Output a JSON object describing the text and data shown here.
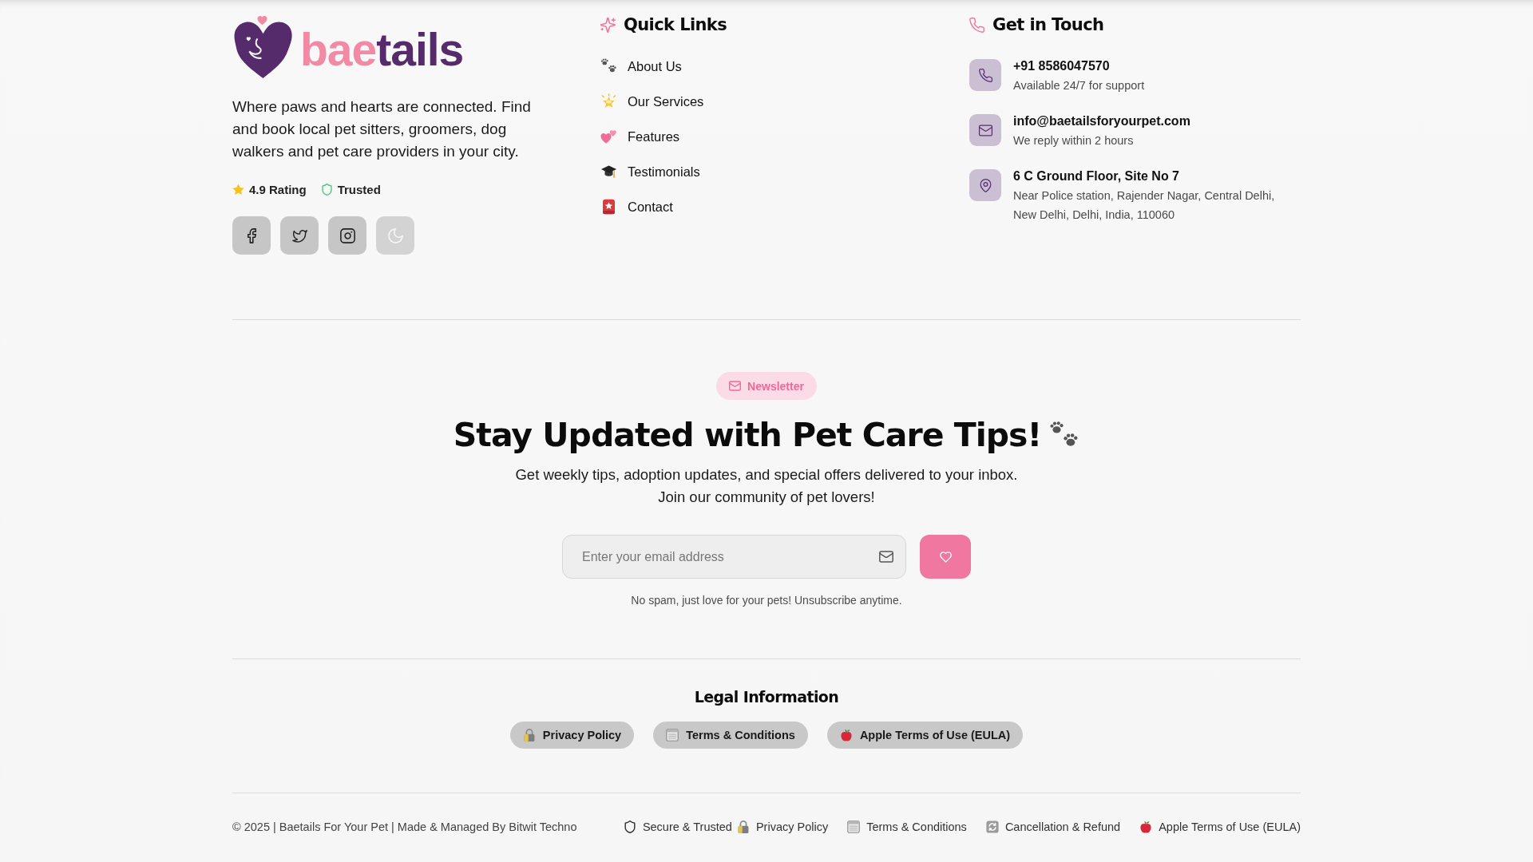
{
  "brand": {
    "logo": {
      "wordmark_start": "bae",
      "wordmark_end": "tails"
    },
    "description": "Where paws and hearts are connected. Find and book local pet sitters, groomers, dog walkers and pet care providers in your city.",
    "badges": [
      {
        "kind": "rating",
        "label": "4.9 Rating"
      },
      {
        "kind": "trusted",
        "label": "Trusted"
      }
    ],
    "social_links": [
      {
        "kind": "facebook",
        "disabled": false
      },
      {
        "kind": "twitter",
        "disabled": false
      },
      {
        "kind": "instagram",
        "disabled": false
      },
      {
        "kind": "moon",
        "disabled": true
      }
    ]
  },
  "quick_links": {
    "title": "Quick Links",
    "links": [
      "About Us",
      "Our Services",
      "Features",
      "Testimonials",
      "Contact"
    ]
  },
  "contact": {
    "title": "Get in Touch",
    "items": [
      {
        "kind": "phone",
        "title": "+91 8586047570",
        "detail": "Available 24/7 for support"
      },
      {
        "kind": "email",
        "title": "info@baetailsforyourpet.com",
        "detail": "We reply within 2 hours"
      },
      {
        "kind": "address",
        "title": "6 C Ground Floor, Site No 7",
        "detail": "Near Police station, Rajender Nagar, Central Delhi, New Delhi, Delhi, India, 110060"
      }
    ]
  },
  "newsletter": {
    "badge": "Newsletter",
    "title": "Stay Updated with Pet Care Tips!",
    "subtitle": "Get weekly tips, adoption updates, and special offers delivered to your inbox. Join our community of pet lovers!",
    "email_field": {
      "placeholder": "Enter your email address"
    },
    "note": "No spam, just love for your pets! Unsubscribe anytime."
  },
  "legal": {
    "title": "Legal Information",
    "links": [
      {
        "kind": "privacy",
        "label": "Privacy Policy"
      },
      {
        "kind": "terms",
        "label": "Terms & Conditions"
      },
      {
        "kind": "apple",
        "label": "Apple Terms of Use (EULA)"
      }
    ]
  },
  "bottom_bar": {
    "copyright": "© 2025 | Baetails For Your Pet | Made & Managed By Bitwit Techno",
    "secure_label": "Secure & Trusted",
    "links": [
      {
        "kind": "privacy",
        "label": "Privacy Policy"
      },
      {
        "kind": "terms",
        "label": "Terms & Conditions"
      },
      {
        "kind": "refund",
        "label": "Cancellation & Refund"
      },
      {
        "kind": "apple",
        "label": "Apple Terms of Use (EULA)"
      }
    ]
  }
}
